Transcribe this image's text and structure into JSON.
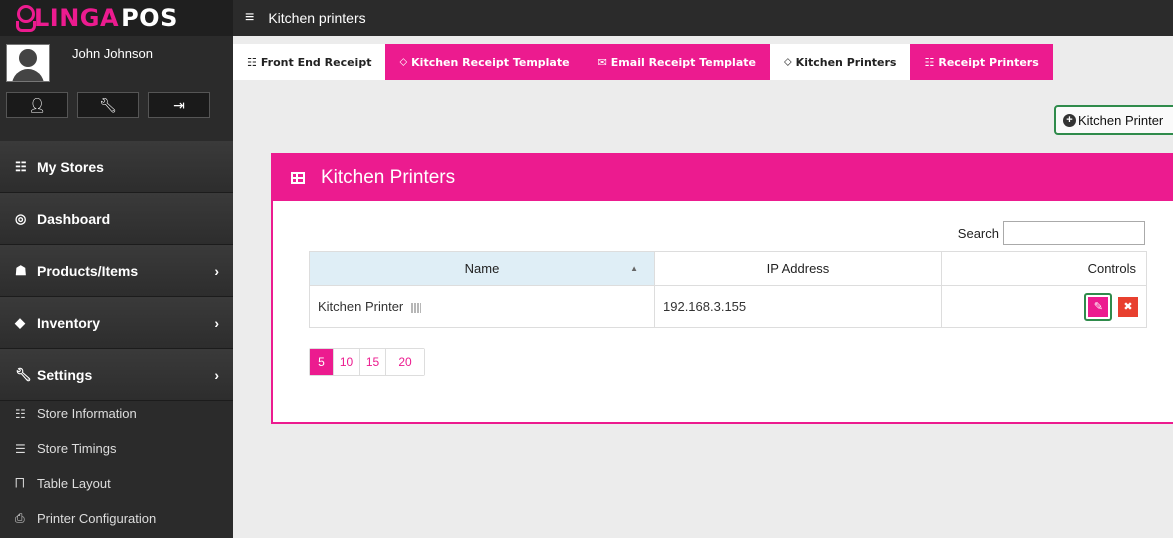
{
  "brand": {
    "logo_part1": "LINGA",
    "logo_part2": "POS",
    "accent": "#ec1b8f"
  },
  "user": {
    "name": "John Johnson"
  },
  "user_buttons": [
    "user-icon",
    "tools-icon",
    "logout-icon"
  ],
  "sidebar": {
    "items": [
      {
        "label": "My Stores",
        "icon": "store-icon",
        "has_arrow": false
      },
      {
        "label": "Dashboard",
        "icon": "dashboard-icon",
        "has_arrow": false
      },
      {
        "label": "Products/Items",
        "icon": "products-icon",
        "has_arrow": true
      },
      {
        "label": "Inventory",
        "icon": "inventory-icon",
        "has_arrow": true
      },
      {
        "label": "Settings",
        "icon": "settings-icon",
        "has_arrow": true
      }
    ],
    "sub_items": [
      {
        "label": "Store Information",
        "icon": "store-info-icon"
      },
      {
        "label": "Store Timings",
        "icon": "store-timings-icon"
      },
      {
        "label": "Table Layout",
        "icon": "table-layout-icon"
      },
      {
        "label": "Printer Configuration",
        "icon": "printer-icon"
      }
    ]
  },
  "header": {
    "title": "Kitchen printers"
  },
  "tabs": [
    {
      "label": "Front End Receipt",
      "style": "white"
    },
    {
      "label": "Kitchen Receipt Template",
      "style": "pink"
    },
    {
      "label": "Email Receipt Template",
      "style": "pink"
    },
    {
      "label": "Kitchen Printers",
      "style": "white"
    },
    {
      "label": "Receipt Printers",
      "style": "pink"
    }
  ],
  "add_button": {
    "label": "Kitchen Printer"
  },
  "panel": {
    "title": "Kitchen Printers"
  },
  "search": {
    "label": "Search",
    "value": ""
  },
  "table": {
    "columns": [
      "Name",
      "IP Address",
      "Controls"
    ],
    "rows": [
      {
        "name": "Kitchen Printer",
        "ip": "192.168.3.155"
      }
    ]
  },
  "pagination": {
    "options": [
      "5",
      "10",
      "15",
      "20"
    ],
    "active": "5"
  }
}
